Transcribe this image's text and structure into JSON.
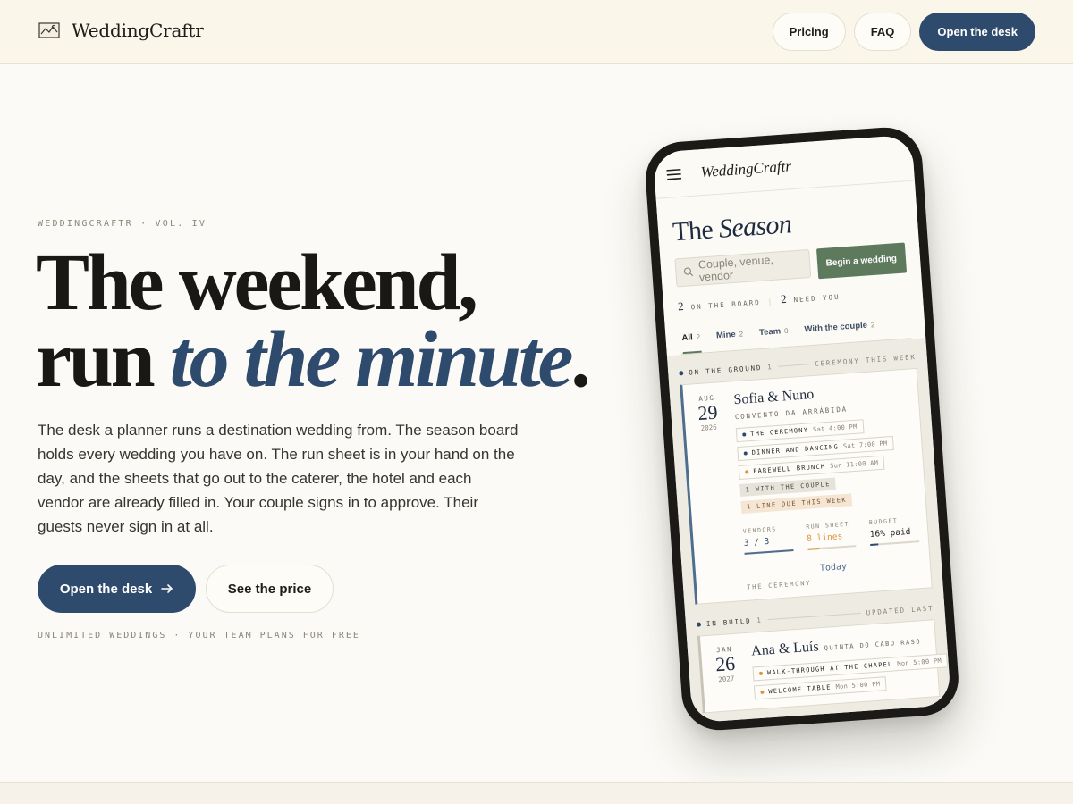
{
  "header": {
    "brand": "WeddingCraftr",
    "nav": {
      "pricing": "Pricing",
      "faq": "FAQ",
      "open": "Open the desk"
    }
  },
  "hero": {
    "eyebrow": "WEDDINGCRAFTR · VOL. IV",
    "headline_plain": "The weekend, run ",
    "headline_accent": "to the minute",
    "headline_end": ".",
    "lede": "The desk a planner runs a destination wedding from. The season board holds every wedding you have on. The run sheet is in your hand on the day, and the sheets that go out to the caterer, the hotel and each vendor are already filled in. Your couple signs in to approve. Their guests never sign in at all.",
    "cta_primary": "Open the desk",
    "cta_secondary": "See the price",
    "footnote": "UNLIMITED WEDDINGS · YOUR TEAM PLANS FOR FREE"
  },
  "phone": {
    "app_brand": "WeddingCraftr",
    "title_plain": "The ",
    "title_italic": "Season",
    "search_placeholder": "Couple, venue, vendor",
    "begin_button": "Begin a wedding",
    "counts": {
      "board_num": "2",
      "board_label": "ON THE BOARD",
      "need_num": "2",
      "need_label": "NEED YOU"
    },
    "tabs": [
      {
        "label": "All",
        "count": "2"
      },
      {
        "label": "Mine",
        "count": "2"
      },
      {
        "label": "Team",
        "count": "0"
      },
      {
        "label": "With the couple",
        "count": "2"
      }
    ],
    "group_ground": {
      "label": "ON THE GROUND",
      "count": "1",
      "right": "CEREMONY THIS WEEK"
    },
    "wedding1": {
      "month": "AUG",
      "day": "29",
      "year": "2026",
      "couple": "Sofia & Nuno",
      "venue": "CONVENTO DA ARRÁBIDA",
      "events": [
        {
          "name": "THE CEREMONY",
          "when": "Sat 4:00 PM",
          "tone": "cool"
        },
        {
          "name": "DINNER AND DANCING",
          "when": "Sat 7:00 PM",
          "tone": "cool"
        },
        {
          "name": "FAREWELL BRUNCH",
          "when": "Sun 11:00 AM",
          "tone": "warm"
        }
      ],
      "tag_couple": "1 WITH THE COUPLE",
      "tag_due": "1 LINE DUE THIS WEEK",
      "stats": {
        "vendors_label": "VENDORS",
        "vendors_value": "3 / 3",
        "vendors_progress": 1.0,
        "run_label": "RUN SHEET",
        "run_value": "8 lines",
        "run_progress": 0.25,
        "budget_label": "BUDGET",
        "budget_value": "16% paid",
        "budget_progress": 0.16
      },
      "today": "Today",
      "today_sub": "THE CEREMONY"
    },
    "group_build": {
      "label": "IN BUILD",
      "count": "1",
      "right": "UPDATED LAST"
    },
    "wedding2": {
      "month": "JAN",
      "day": "26",
      "year": "2027",
      "couple": "Ana & Luís",
      "venue": "QUINTA DO CABO RASO",
      "events": [
        {
          "name": "WALK-THROUGH AT THE CHAPEL",
          "when": "Mon 5:00 PM",
          "tone": "warm"
        },
        {
          "name": "WELCOME TABLE",
          "when": "Mon 5:00 PM",
          "tone": "warm"
        }
      ]
    }
  },
  "colors": {
    "accent": "#2e4a6d",
    "sage": "#5e7a5d",
    "warm": "#d9963e",
    "background": "#fbfaf6"
  },
  "icons": [
    "sketch-logo-icon",
    "arrow-right-icon",
    "menu-icon",
    "search-icon"
  ]
}
